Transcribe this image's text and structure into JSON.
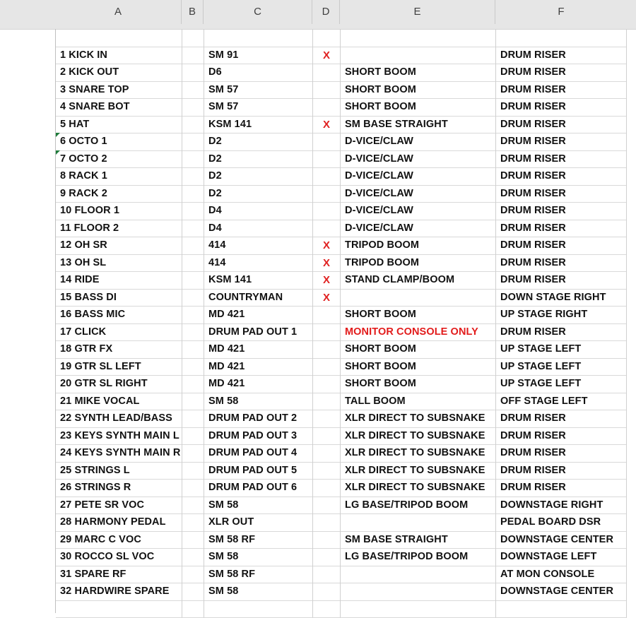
{
  "columns": [
    "A",
    "B",
    "C",
    "D",
    "E",
    "F"
  ],
  "rows": [
    {
      "a": "",
      "c": "",
      "d": "",
      "e": "",
      "f": ""
    },
    {
      "a": "1 KICK IN",
      "c": "SM 91",
      "d": "X",
      "e": "",
      "f": "DRUM RISER"
    },
    {
      "a": "2 KICK OUT",
      "c": "D6",
      "d": "",
      "e": "SHORT BOOM",
      "f": "DRUM RISER"
    },
    {
      "a": "3 SNARE TOP",
      "c": "SM 57",
      "d": "",
      "e": "SHORT BOOM",
      "f": "DRUM RISER"
    },
    {
      "a": "4 SNARE BOT",
      "c": "SM 57",
      "d": "",
      "e": "SHORT BOOM",
      "f": "DRUM RISER"
    },
    {
      "a": "5 HAT",
      "c": "KSM 141",
      "d": "X",
      "e": "SM BASE STRAIGHT",
      "f": "DRUM RISER"
    },
    {
      "a": "6 OCTO 1",
      "c": "D2",
      "d": "",
      "e": "D-VICE/CLAW",
      "f": "DRUM RISER",
      "flag": true
    },
    {
      "a": "7 OCTO 2",
      "c": "D2",
      "d": "",
      "e": "D-VICE/CLAW",
      "f": "DRUM RISER",
      "flag": true
    },
    {
      "a": "8 RACK 1",
      "c": "D2",
      "d": "",
      "e": "D-VICE/CLAW",
      "f": "DRUM RISER"
    },
    {
      "a": "9 RACK 2",
      "c": "D2",
      "d": "",
      "e": "D-VICE/CLAW",
      "f": "DRUM RISER"
    },
    {
      "a": "10 FLOOR 1",
      "c": "D4",
      "d": "",
      "e": "D-VICE/CLAW",
      "f": "DRUM RISER"
    },
    {
      "a": "11 FLOOR 2",
      "c": "D4",
      "d": "",
      "e": "D-VICE/CLAW",
      "f": "DRUM RISER"
    },
    {
      "a": "12 OH SR",
      "c": "414",
      "d": "X",
      "e": "TRIPOD BOOM",
      "f": "DRUM RISER"
    },
    {
      "a": "13 OH SL",
      "c": "414",
      "d": "X",
      "e": "TRIPOD BOOM",
      "f": "DRUM RISER"
    },
    {
      "a": "14 RIDE",
      "c": "KSM 141",
      "d": "X",
      "e": "STAND CLAMP/BOOM",
      "f": "DRUM RISER"
    },
    {
      "a": "15 BASS DI",
      "c": "COUNTRYMAN",
      "d": "X",
      "e": "",
      "f": "DOWN STAGE RIGHT"
    },
    {
      "a": "16 BASS MIC",
      "c": "MD 421",
      "d": "",
      "e": "SHORT BOOM",
      "f": "UP STAGE RIGHT"
    },
    {
      "a": "17 CLICK",
      "c": "DRUM PAD OUT 1",
      "d": "",
      "e": "MONITOR CONSOLE ONLY",
      "f": "DRUM RISER",
      "e_red": true
    },
    {
      "a": "18 GTR FX",
      "c": "MD 421",
      "d": "",
      "e": "SHORT BOOM",
      "f": "UP STAGE LEFT"
    },
    {
      "a": "19 GTR SL LEFT",
      "c": "MD 421",
      "d": "",
      "e": "SHORT BOOM",
      "f": "UP STAGE LEFT"
    },
    {
      "a": "20 GTR SL RIGHT",
      "c": "MD 421",
      "d": "",
      "e": "SHORT BOOM",
      "f": "UP STAGE LEFT"
    },
    {
      "a": "21 MIKE VOCAL",
      "c": "SM 58",
      "d": "",
      "e": "TALL BOOM",
      "f": "OFF STAGE LEFT"
    },
    {
      "a": "22 SYNTH LEAD/BASS",
      "c": "DRUM PAD OUT 2",
      "d": "",
      "e": "XLR DIRECT TO SUBSNAKE",
      "f": "DRUM RISER"
    },
    {
      "a": "23 KEYS SYNTH MAIN L",
      "c": "DRUM PAD OUT 3",
      "d": "",
      "e": "XLR DIRECT TO SUBSNAKE",
      "f": "DRUM RISER"
    },
    {
      "a": "24 KEYS SYNTH MAIN R",
      "c": "DRUM PAD OUT 4",
      "d": "",
      "e": "XLR DIRECT TO SUBSNAKE",
      "f": "DRUM RISER"
    },
    {
      "a": "25 STRINGS L",
      "c": "DRUM PAD OUT 5",
      "d": "",
      "e": "XLR DIRECT TO SUBSNAKE",
      "f": "DRUM RISER"
    },
    {
      "a": "26 STRINGS R",
      "c": "DRUM PAD OUT 6",
      "d": "",
      "e": "XLR DIRECT TO SUBSNAKE",
      "f": "DRUM RISER"
    },
    {
      "a": "27 PETE SR VOC",
      "c": "SM 58",
      "d": "",
      "e": "LG BASE/TRIPOD BOOM",
      "f": "DOWNSTAGE RIGHT"
    },
    {
      "a": "28 HARMONY PEDAL",
      "c": "XLR OUT",
      "d": "",
      "e": "",
      "f": "PEDAL BOARD DSR"
    },
    {
      "a": "29 MARC C VOC",
      "c": "SM 58 RF",
      "d": "",
      "e": "SM BASE STRAIGHT",
      "f": "DOWNSTAGE CENTER"
    },
    {
      "a": "30 ROCCO SL VOC",
      "c": "SM 58",
      "d": "",
      "e": "LG BASE/TRIPOD BOOM",
      "f": "DOWNSTAGE LEFT"
    },
    {
      "a": "31 SPARE RF",
      "c": "SM 58 RF",
      "d": "",
      "e": "",
      "f": "AT MON CONSOLE"
    },
    {
      "a": "32 HARDWIRE SPARE",
      "c": "SM 58",
      "d": "",
      "e": "",
      "f": "DOWNSTAGE CENTER"
    },
    {
      "a": "",
      "c": "",
      "d": "",
      "e": "",
      "f": ""
    }
  ]
}
